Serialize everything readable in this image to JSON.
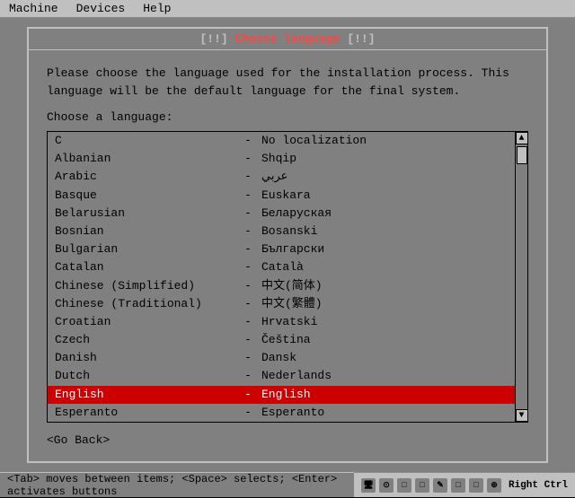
{
  "menubar": {
    "items": [
      {
        "label": "Machine",
        "id": "machine"
      },
      {
        "label": "Devices",
        "id": "devices"
      },
      {
        "label": "Help",
        "id": "help"
      }
    ]
  },
  "dialog": {
    "title_prefix": "[!!]",
    "title_main": " Choose language ",
    "description_line1": "Please choose the language used for the installation process. This",
    "description_line2": "language will be the default language for the final system.",
    "choose_label": "Choose a language:",
    "languages": [
      {
        "name": "C",
        "sep": "-",
        "native": "No localization"
      },
      {
        "name": "Albanian",
        "sep": "-",
        "native": "Shqip"
      },
      {
        "name": "Arabic",
        "sep": "-",
        "native": "عربي"
      },
      {
        "name": "Basque",
        "sep": "-",
        "native": "Euskara"
      },
      {
        "name": "Belarusian",
        "sep": "-",
        "native": "Беларуская"
      },
      {
        "name": "Bosnian",
        "sep": "-",
        "native": "Bosanski"
      },
      {
        "name": "Bulgarian",
        "sep": "-",
        "native": "Български"
      },
      {
        "name": "Catalan",
        "sep": "-",
        "native": "Català"
      },
      {
        "name": "Chinese (Simplified)",
        "sep": "-",
        "native": "中文(简体)"
      },
      {
        "name": "Chinese (Traditional)",
        "sep": "-",
        "native": "中文(繁體)"
      },
      {
        "name": "Croatian",
        "sep": "-",
        "native": "Hrvatski"
      },
      {
        "name": "Czech",
        "sep": "-",
        "native": "Čeština"
      },
      {
        "name": "Danish",
        "sep": "-",
        "native": "Dansk"
      },
      {
        "name": "Dutch",
        "sep": "-",
        "native": "Nederlands"
      },
      {
        "name": "English",
        "sep": "-",
        "native": "English",
        "selected": true
      },
      {
        "name": "Esperanto",
        "sep": "-",
        "native": "Esperanto"
      }
    ],
    "go_back": "<Go Back>"
  },
  "statusbar": {
    "text": "<Tab> moves between items; <Space> selects; <Enter> activates buttons"
  },
  "tray": {
    "right_ctrl": "Right Ctrl"
  }
}
